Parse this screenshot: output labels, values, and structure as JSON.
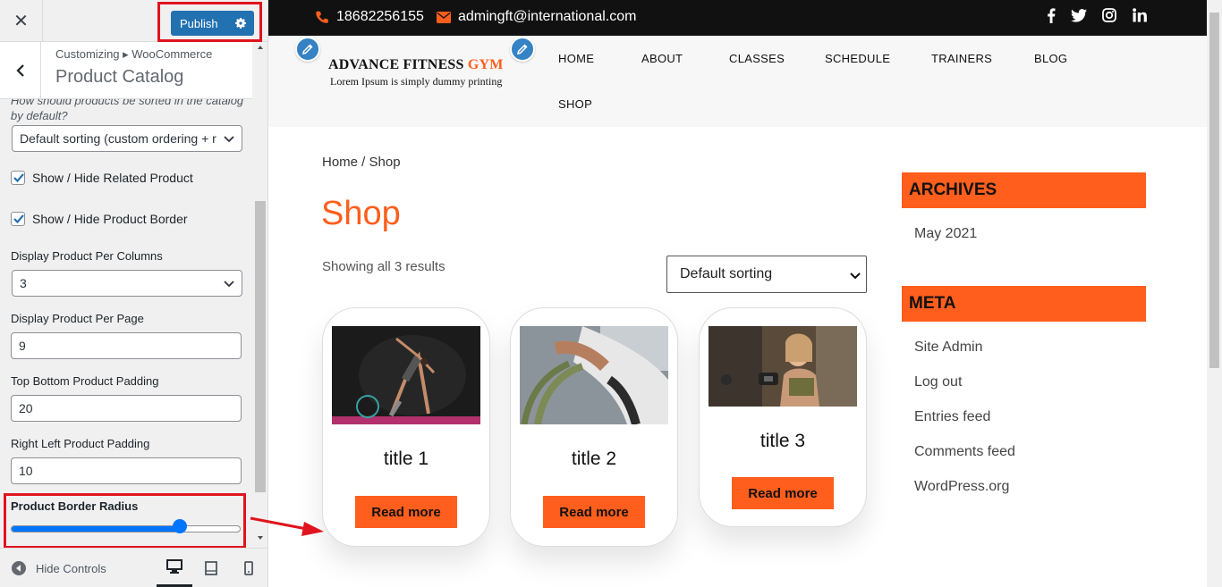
{
  "sidebar": {
    "close_label": "✕",
    "publish_label": "Publish",
    "breadcrumb": "Customizing ▸ WooCommerce",
    "section_title": "Product Catalog",
    "cut_description": "How should products be sorted in the catalog by default?",
    "sorting_select": "Default sorting (custom ordering + r",
    "related_label": "Show / Hide Related Product",
    "border_label": "Show / Hide Product Border",
    "columns_label": "Display Product Per Columns",
    "columns_value": "3",
    "per_page_label": "Display Product Per Page",
    "per_page_value": "9",
    "tb_padding_label": "Top Bottom Product Padding",
    "tb_padding_value": "20",
    "rl_padding_label": "Right Left Product Padding",
    "rl_padding_value": "10",
    "radius_label": "Product Border Radius",
    "radius_fraction": 0.75,
    "hide_controls": "Hide Controls"
  },
  "topbar": {
    "phone": "18682256155",
    "email": "admingft@international.com",
    "social": [
      "facebook-icon",
      "twitter-icon",
      "instagram-icon",
      "linkedin-icon"
    ]
  },
  "header": {
    "logo_main": "ADVANCE FITNESS ",
    "logo_accent": "GYM",
    "logo_sub": "Lorem Ipsum is simply dummy printing",
    "nav": [
      "HOME",
      "ABOUT",
      "CLASSES",
      "SCHEDULE",
      "TRAINERS",
      "BLOG",
      "SHOP"
    ]
  },
  "shop": {
    "breadcrumb": "Home / Shop",
    "title": "Shop",
    "result_count": "Showing all 3 results",
    "orderby": "Default sorting",
    "products": [
      {
        "title": "title 1",
        "button": "Read more"
      },
      {
        "title": "title 2",
        "button": "Read more"
      },
      {
        "title": "title 3",
        "button": "Read more"
      }
    ]
  },
  "widgets": {
    "archives_title": "ARCHIVES",
    "archives": [
      "May 2021"
    ],
    "meta_title": "META",
    "meta": [
      "Site Admin",
      "Log out",
      "Entries feed",
      "Comments feed",
      "WordPress.org"
    ]
  },
  "colors": {
    "accent": "#ff5e1d",
    "wp_blue": "#2271b1",
    "highlight": "#e0141e",
    "slider": "#0075ff"
  }
}
